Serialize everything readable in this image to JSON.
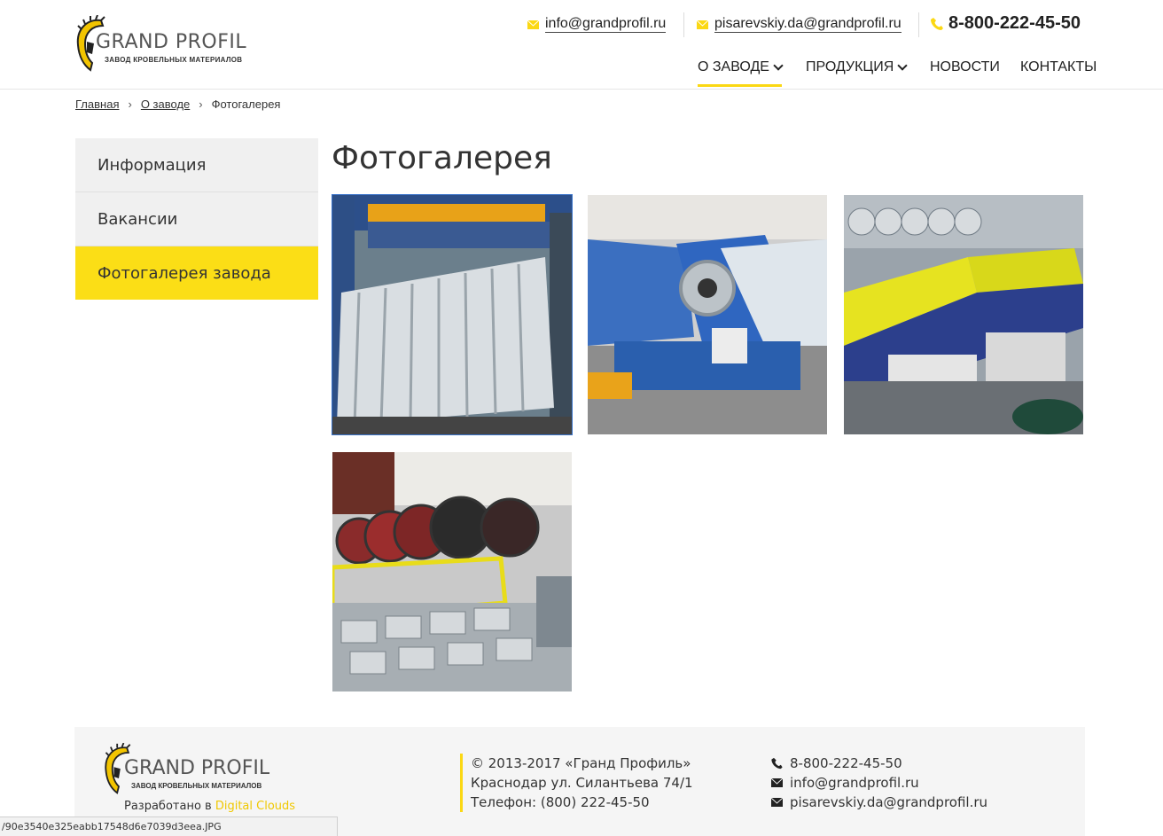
{
  "header": {
    "logo": {
      "brand": "GRAND PROFIL",
      "tagline": "ЗАВОД КРОВЕЛЬНЫХ МАТЕРИАЛОВ"
    },
    "email1": "info@grandprofil.ru",
    "email2": "pisarevskiy.da@grandprofil.ru",
    "phone": "8-800-222-45-50",
    "nav": [
      {
        "label": "О ЗАВОДЕ",
        "active": true,
        "dropdown": true
      },
      {
        "label": "ПРОДУКЦИЯ",
        "active": false,
        "dropdown": true
      },
      {
        "label": "НОВОСТИ",
        "active": false,
        "dropdown": false
      },
      {
        "label": "КОНТАКТЫ",
        "active": false,
        "dropdown": false
      }
    ]
  },
  "breadcrumb": {
    "home": "Главная",
    "parent": "О заводе",
    "current": "Фотогалерея",
    "separator": "›"
  },
  "sidebar": {
    "items": [
      {
        "label": "Информация",
        "active": false
      },
      {
        "label": "Вакансии",
        "active": false
      },
      {
        "label": "Фотогалерея завода",
        "active": true
      }
    ]
  },
  "main": {
    "title": "Фотогалерея",
    "photos": [
      {
        "subject": "corrugated sheet rolling line",
        "selected": true
      },
      {
        "subject": "steel coil uncoiler",
        "selected": false
      },
      {
        "subject": "roll forming machines with yellow guards",
        "selected": false
      },
      {
        "subject": "steel coils and roll former",
        "selected": false
      }
    ]
  },
  "footer": {
    "logo": {
      "brand": "GRAND PROFIL",
      "tagline": "ЗАВОД КРОВЕЛЬНЫХ МАТЕРИАЛОВ"
    },
    "developed_by": "Разработано в",
    "developer": "Digital Clouds",
    "copyright": "© 2013-2017 «Гранд Профиль»",
    "address": "Краснодар ул. Силантьева 74/1",
    "phone_line": "Телефон: (800) 222-45-50",
    "phone": "8-800-222-45-50",
    "email1": "info@grandprofil.ru",
    "email2": "pisarevskiy.da@grandprofil.ru"
  },
  "statusbar": {
    "url": "/90e3540e325eabb17548d6e7039d3eea.JPG"
  },
  "colors": {
    "accent": "#fbd814",
    "sidebar_bg": "#f0f0f0",
    "footer_bg": "#f5f5f5",
    "selected_outline": "#3a73c9"
  }
}
